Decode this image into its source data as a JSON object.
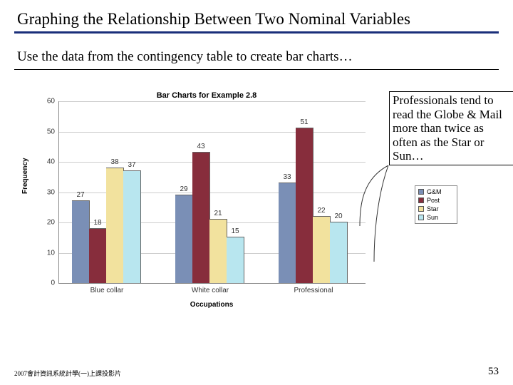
{
  "title": "Graphing the Relationship Between Two Nominal Variables",
  "subtitle": "Use the data from the contingency table to create bar charts…",
  "note": "Professionals tend to read the Globe & Mail more than twice as often as the Star or Sun…",
  "footer_left": "2007會計資訊系統計學(一)上課投影片",
  "footer_right": "53",
  "chart_data": {
    "type": "bar",
    "title": "Bar Charts for Example 2.8",
    "xlabel": "Occupations",
    "ylabel": "Frequency",
    "ylim": [
      0,
      60
    ],
    "y_ticks": [
      0,
      10,
      20,
      30,
      40,
      50,
      60
    ],
    "categories": [
      "Blue collar",
      "White collar",
      "Professional"
    ],
    "series": [
      {
        "name": "G&M",
        "color": "#7a8fb6",
        "values": [
          27,
          29,
          33
        ]
      },
      {
        "name": "Post",
        "color": "#872d3c",
        "values": [
          18,
          43,
          51
        ]
      },
      {
        "name": "Star",
        "color": "#f2e29e",
        "values": [
          38,
          21,
          22
        ]
      },
      {
        "name": "Sun",
        "color": "#b8e6ef",
        "values": [
          37,
          15,
          20
        ]
      }
    ],
    "legend_position": "right"
  }
}
